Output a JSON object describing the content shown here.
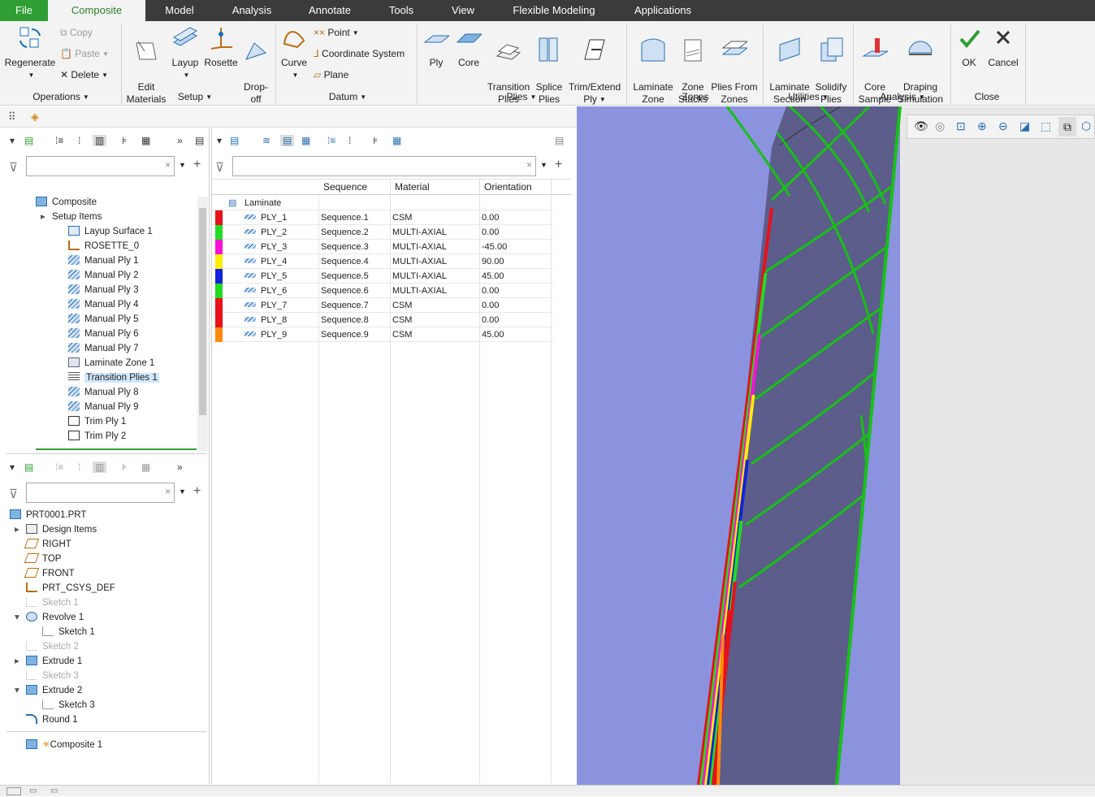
{
  "menubar": {
    "tabs": [
      "File",
      "Composite",
      "Model",
      "Analysis",
      "Annotate",
      "Tools",
      "View",
      "Flexible Modeling",
      "Applications"
    ]
  },
  "ribbon": {
    "regenerate": "Regenerate",
    "copy": "Copy",
    "paste": "Paste",
    "delete": "Delete",
    "edit_materials": "Edit\nMaterials",
    "layup": "Layup",
    "rosette": "Rosette",
    "drop_off": "Drop-\noff",
    "curve": "Curve",
    "point": "Point",
    "coordinate_system": "Coordinate System",
    "plane": "Plane",
    "ply": "Ply",
    "core": "Core",
    "transition_plies": "Transition\nPlies",
    "splice_plies": "Splice\nPlies",
    "trim_extend": "Trim/Extend\nPly",
    "laminate_zone": "Laminate\nZone",
    "zone_stacks": "Zone\nStacks",
    "plies_from_zones": "Plies From\nZones",
    "laminate_section": "Laminate\nSection",
    "solidify_plies": "Solidify\nPlies",
    "core_sample": "Core\nSample",
    "draping_simulation": "Draping\nSimulation",
    "ok": "OK",
    "cancel": "Cancel",
    "groups": {
      "operations": "Operations",
      "setup": "Setup",
      "datum": "Datum",
      "plies": "Plies",
      "zones": "Zones",
      "utilities": "Utilities",
      "analysis": "Analysis",
      "close": "Close"
    }
  },
  "composite_tree": {
    "items": [
      {
        "label": "Composite",
        "indent": 0,
        "icon": "composite-icon"
      },
      {
        "label": "Setup Items",
        "indent": 1,
        "icon": "none",
        "expand": true
      },
      {
        "label": "Layup Surface 1",
        "indent": 2,
        "icon": "layup-surface-icon"
      },
      {
        "label": "ROSETTE_0",
        "indent": 2,
        "icon": "rosette-icon"
      },
      {
        "label": "Manual Ply 1",
        "indent": 2,
        "icon": "ply-icon"
      },
      {
        "label": "Manual Ply 2",
        "indent": 2,
        "icon": "ply-icon"
      },
      {
        "label": "Manual Ply 3",
        "indent": 2,
        "icon": "ply-icon"
      },
      {
        "label": "Manual Ply 4",
        "indent": 2,
        "icon": "ply-icon"
      },
      {
        "label": "Manual Ply 5",
        "indent": 2,
        "icon": "ply-icon"
      },
      {
        "label": "Manual Ply 6",
        "indent": 2,
        "icon": "ply-icon"
      },
      {
        "label": "Manual Ply 7",
        "indent": 2,
        "icon": "ply-icon"
      },
      {
        "label": "Laminate Zone 1",
        "indent": 2,
        "icon": "laminate-zone-icon"
      },
      {
        "label": "Transition Plies 1",
        "indent": 2,
        "icon": "transition-plies-icon",
        "selected": true
      },
      {
        "label": "Manual Ply 8",
        "indent": 2,
        "icon": "ply-icon"
      },
      {
        "label": "Manual Ply 9",
        "indent": 2,
        "icon": "ply-icon"
      },
      {
        "label": "Trim Ply 1",
        "indent": 2,
        "icon": "trim-ply-icon"
      },
      {
        "label": "Trim Ply 2",
        "indent": 2,
        "icon": "trim-ply-icon"
      }
    ]
  },
  "model_tree": {
    "items": [
      {
        "label": "PRT0001.PRT",
        "indent": 0,
        "icon": "part-icon"
      },
      {
        "label": "Design Items",
        "indent": 1,
        "icon": "design-items-icon",
        "expand": "right"
      },
      {
        "label": "RIGHT",
        "indent": 1,
        "icon": "datum-plane-icon"
      },
      {
        "label": "TOP",
        "indent": 1,
        "icon": "datum-plane-icon"
      },
      {
        "label": "FRONT",
        "indent": 1,
        "icon": "datum-plane-icon"
      },
      {
        "label": "PRT_CSYS_DEF",
        "indent": 1,
        "icon": "csys-icon"
      },
      {
        "label": "Sketch 1",
        "indent": 1,
        "icon": "sketch-icon",
        "dim": true
      },
      {
        "label": "Revolve 1",
        "indent": 1,
        "icon": "revolve-icon",
        "expand": "down"
      },
      {
        "label": "Sketch 1",
        "indent": 2,
        "icon": "sketch-icon"
      },
      {
        "label": "Sketch 2",
        "indent": 1,
        "icon": "sketch-icon",
        "dim": true
      },
      {
        "label": "Extrude 1",
        "indent": 1,
        "icon": "extrude-icon",
        "expand": "right"
      },
      {
        "label": "Sketch 3",
        "indent": 1,
        "icon": "sketch-icon",
        "dim": true
      },
      {
        "label": "Extrude 2",
        "indent": 1,
        "icon": "extrude-icon",
        "expand": "down"
      },
      {
        "label": "Sketch 3",
        "indent": 2,
        "icon": "sketch-icon"
      },
      {
        "label": "Round 1",
        "indent": 1,
        "icon": "round-icon"
      }
    ],
    "footer": "Composite 1"
  },
  "laminate_table": {
    "columns": [
      "Sequence",
      "Material",
      "Orientation"
    ],
    "root": "Laminate",
    "rows": [
      {
        "ply": "PLY_1",
        "sequence": "Sequence.1",
        "material": "CSM",
        "orientation": "0.00",
        "color": "#e8101a"
      },
      {
        "ply": "PLY_2",
        "sequence": "Sequence.2",
        "material": "MULTI-AXIAL",
        "orientation": "0.00",
        "color": "#20dd20"
      },
      {
        "ply": "PLY_3",
        "sequence": "Sequence.3",
        "material": "MULTI-AXIAL",
        "orientation": "-45.00",
        "color": "#ff10d8"
      },
      {
        "ply": "PLY_4",
        "sequence": "Sequence.4",
        "material": "MULTI-AXIAL",
        "orientation": "90.00",
        "color": "#ffee00"
      },
      {
        "ply": "PLY_5",
        "sequence": "Sequence.5",
        "material": "MULTI-AXIAL",
        "orientation": "45.00",
        "color": "#1222dd"
      },
      {
        "ply": "PLY_6",
        "sequence": "Sequence.6",
        "material": "MULTI-AXIAL",
        "orientation": "0.00",
        "color": "#20dd20"
      },
      {
        "ply": "PLY_7",
        "sequence": "Sequence.7",
        "material": "CSM",
        "orientation": "0.00",
        "color": "#e8101a"
      },
      {
        "ply": "PLY_8",
        "sequence": "Sequence.8",
        "material": "CSM",
        "orientation": "0.00",
        "color": "#e8101a"
      },
      {
        "ply": "PLY_9",
        "sequence": "Sequence.9",
        "material": "CSM",
        "orientation": "45.00",
        "color": "#ff8a10"
      }
    ]
  },
  "colors": {
    "accent": "#2f9e35",
    "menubar": "#3b3b3b",
    "model_face": "#5c5d8a",
    "model_bg": "#8b93de",
    "curve": "#18c018"
  }
}
